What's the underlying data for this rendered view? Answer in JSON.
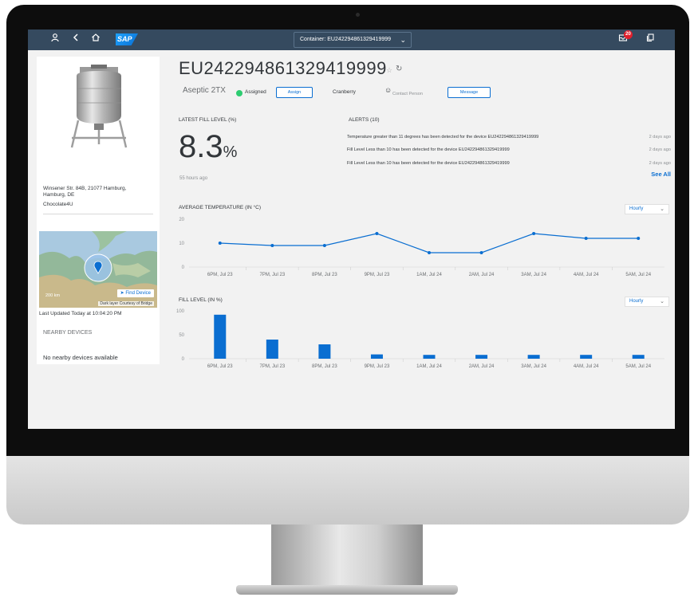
{
  "shell": {
    "container_label": "Container: EU242294861329419999",
    "notification_count": "20"
  },
  "device": {
    "id": "EU242294861329419999",
    "subtitle": "Aseptic 2TX",
    "status": "Assigned",
    "assign_label": "Assign",
    "variety": "Cranberry",
    "contact_person": "Contact Person",
    "message_label": "Message"
  },
  "left": {
    "address_line1": "Winsener Str. 84B, 21077 Hamburg,",
    "address_line2": "Hamburg, DE",
    "owner": "Chocolate4U",
    "map_scale": "200 km",
    "find_device": "Find Device",
    "map_attribution": "Dark layer Courtesy of Bridge",
    "last_updated": "Last Updated Today at 10:04:20 PM",
    "nearby_title": "NEARBY DEVICES",
    "nearby_empty": "No nearby devices available"
  },
  "fill_level": {
    "title": "LATEST FILL LEVEL (%)",
    "value": "8.3",
    "unit": "%",
    "ago": "55 hours ago"
  },
  "alerts": {
    "title": "ALERTS (10)",
    "items": [
      {
        "text": "Temperature greater than 11 degrees has been detected for the device EU242294861329419999",
        "ago": "2 days ago"
      },
      {
        "text": "Fill Level Less than 10 has been detected for the device EU242294861329419999",
        "ago": "2 days ago"
      },
      {
        "text": "Fill Level Less than 10 has been detected for the device EU242294861329419999",
        "ago": "2 days ago"
      }
    ],
    "see_all": "See All"
  },
  "temp_section": {
    "title": "AVERAGE TEMPERATURE (IN °C)",
    "interval": "Hourly"
  },
  "fill_section": {
    "title": "FILL LEVEL (IN %)",
    "interval": "Hourly"
  },
  "chart_data": [
    {
      "type": "line",
      "title": "AVERAGE TEMPERATURE (IN °C)",
      "categories": [
        "6PM, Jul 23",
        "7PM, Jul 23",
        "8PM, Jul 23",
        "9PM, Jul 23",
        "1AM, Jul 24",
        "2AM, Jul 24",
        "3AM, Jul 24",
        "4AM, Jul 24",
        "5AM, Jul 24"
      ],
      "values": [
        10,
        9,
        9,
        14,
        6,
        6,
        14,
        12,
        12
      ],
      "yticks": [
        0,
        10,
        20
      ],
      "ylim": [
        0,
        20
      ],
      "color": "#0a6ed1"
    },
    {
      "type": "bar",
      "title": "FILL LEVEL (IN %)",
      "categories": [
        "6PM, Jul 23",
        "7PM, Jul 23",
        "8PM, Jul 23",
        "9PM, Jul 23",
        "1AM, Jul 24",
        "2AM, Jul 24",
        "3AM, Jul 24",
        "4AM, Jul 24",
        "5AM, Jul 24"
      ],
      "values": [
        92,
        40,
        30,
        9,
        8,
        8,
        8,
        8,
        8
      ],
      "yticks": [
        0,
        50,
        100
      ],
      "ylim": [
        0,
        100
      ],
      "color": "#0a6ed1"
    }
  ]
}
